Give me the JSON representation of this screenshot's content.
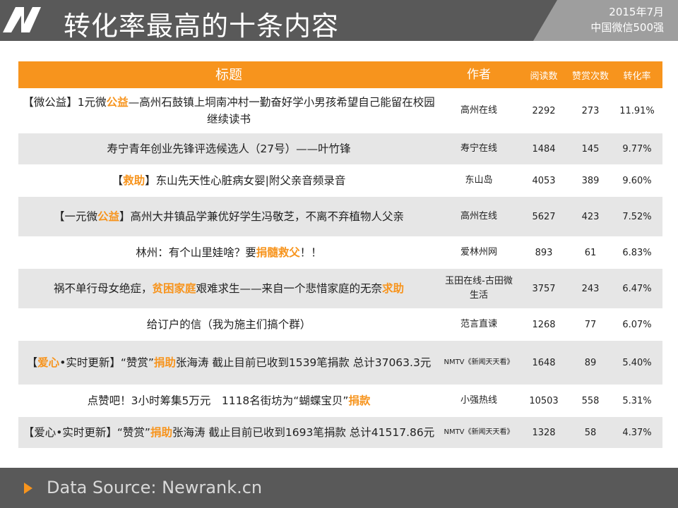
{
  "header": {
    "title": "转化率最高的十条内容",
    "corner_line1": "2015年7月",
    "corner_line2": "中国微信500强"
  },
  "table": {
    "columns": {
      "title": "标题",
      "author": "作者",
      "read": "阅读数",
      "likes": "赞赏次数",
      "rate": "转化率"
    },
    "rows": [
      {
        "title_parts": [
          "【微公益】1元微",
          "公益",
          "—高州石鼓镇上垌南冲村一勤奋好学小男孩希望自己能留在校园继续读书"
        ],
        "author": "高州在线",
        "read": "2292",
        "likes": "273",
        "rate": "11.91%"
      },
      {
        "title_parts": [
          "寿宁青年创业先锋评选候选人（27号）——叶竹锋"
        ],
        "author": "寿宁在线",
        "read": "1484",
        "likes": "145",
        "rate": "9.77%"
      },
      {
        "title_parts": [
          "【",
          "救助",
          "】东山先天性心脏病女婴|附父亲音频录音"
        ],
        "author": "东山岛",
        "read": "4053",
        "likes": "389",
        "rate": "9.60%"
      },
      {
        "title_parts": [
          "【一元微",
          "公益",
          "】高州大井镇品学兼优好学生冯敬芝，不离不弃植物人父亲"
        ],
        "author": "高州在线",
        "read": "5627",
        "likes": "423",
        "rate": "7.52%"
      },
      {
        "title_parts": [
          "林州：有个山里娃啥？要",
          "捐髓救父",
          "！！"
        ],
        "author": "爱林州网",
        "read": "893",
        "likes": "61",
        "rate": "6.83%"
      },
      {
        "title_parts": [
          "祸不单行母女绝症，",
          "贫困家庭",
          "艰难求生——来自一个悲惜家庭的无奈",
          "求助",
          ""
        ],
        "author": "玉田在线-古田微生活",
        "read": "3757",
        "likes": "243",
        "rate": "6.47%"
      },
      {
        "title_parts": [
          "给订户的信（我为施主们搞个群）"
        ],
        "author": "范言直谏",
        "read": "1268",
        "likes": "77",
        "rate": "6.07%"
      },
      {
        "title_parts": [
          "【",
          "爱心",
          "•实时更新】“赞赏”",
          "捐助",
          "张海涛 截止目前已收到1539笔捐款 总计37063.3元"
        ],
        "author": "NMTV《新闻天天看》",
        "read": "1648",
        "likes": "89",
        "rate": "5.40%"
      },
      {
        "title_parts": [
          "点赞吧！3小时筹集5万元　1118名街坊为“蝴蝶宝贝”",
          "捐款",
          ""
        ],
        "author": "小强热线",
        "read": "10503",
        "likes": "558",
        "rate": "5.31%"
      },
      {
        "title_parts": [
          "【爱心•实时更新】“赞赏”",
          "捐助",
          "张海涛 截止目前已收到1693笔捐款 总计41517.86元"
        ],
        "author": "NMTV《新闻天天看》",
        "read": "1328",
        "likes": "58",
        "rate": "4.37%"
      }
    ]
  },
  "footer": {
    "source": "Data Source: Newrank.cn"
  },
  "colors": {
    "accent": "#f7941d",
    "header_bg": "#595959",
    "row_alt": "#e6e6e6"
  }
}
